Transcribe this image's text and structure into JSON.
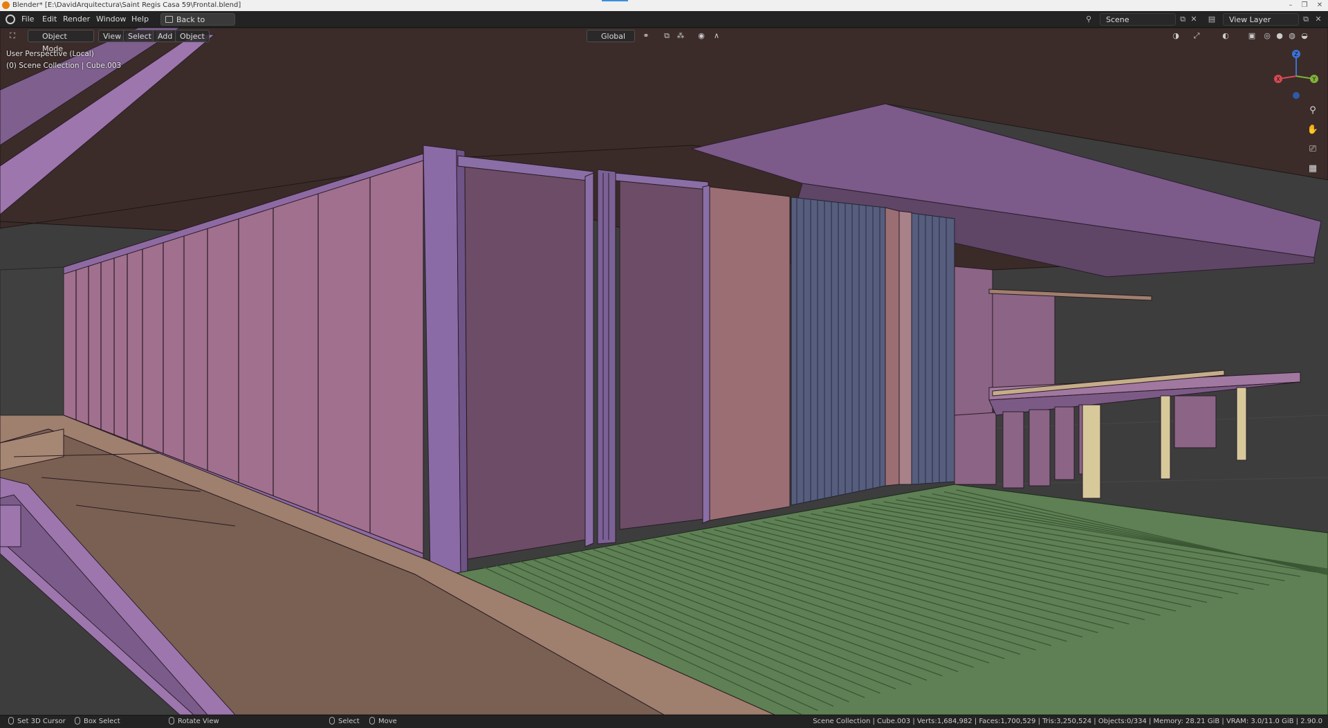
{
  "window": {
    "title": "Blender* [E:\\DavidArquitectura\\Saint Regis Casa 59\\Frontal.blend]",
    "controls": [
      "–",
      "❐",
      "✕"
    ]
  },
  "menubar": {
    "items": [
      "File",
      "Edit",
      "Render",
      "Window",
      "Help"
    ],
    "back_button": "Back to Previous",
    "scene": "Scene",
    "view_layer": "View Layer"
  },
  "viewport_header": {
    "mode": "Object Mode",
    "menus": [
      "View",
      "Select",
      "Add",
      "Object"
    ],
    "orientation": "Global"
  },
  "overlay": {
    "perspective": "User Perspective (Local)",
    "collection": "(0) Scene Collection | Cube.003"
  },
  "gizmo": {
    "x": "X",
    "y": "Y",
    "z": "Z"
  },
  "statusbar": {
    "left": [
      "Set 3D Cursor",
      "Box Select",
      "Rotate View",
      "Select",
      "Move"
    ],
    "info": "Scene Collection | Cube.003 | Verts:1,684,982 | Faces:1,700,529 | Tris:3,250,524 | Objects:0/334 | Memory: 28.21 GiB | VRAM: 3.0/11.0 GiB | 2.90.0"
  },
  "colors": {
    "ceiling": "#3b2c29",
    "wall_pink": "#a1708e",
    "wall_dark": "#6c4c66",
    "frame_purple": "#8a6ea6",
    "floor_green": "#5e8054",
    "floor_tan": "#9f7f6d",
    "beam": "#7c5a8a"
  }
}
